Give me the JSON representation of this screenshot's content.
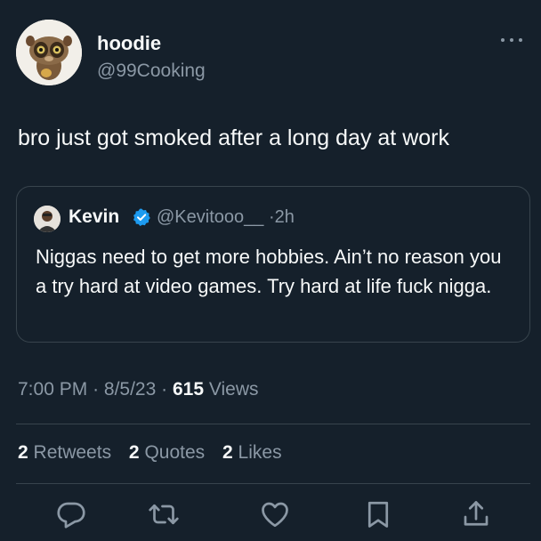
{
  "author": {
    "name": "hoodie",
    "handle": "@99Cooking"
  },
  "tweet_text": "bro just got smoked after a long day at work",
  "quoted": {
    "name": "Kevin",
    "handle": "@Kevitooo__",
    "separator": "·",
    "time_ago": "2h",
    "text": "Niggas need to get more hobbies. Ain’t no reason you a try hard at video games. Try hard at life fuck nigga."
  },
  "meta": {
    "time": "7:00 PM",
    "dot1": "·",
    "date": "8/5/23",
    "dot2": "·",
    "views_count": "615",
    "views_label": "Views"
  },
  "stats": {
    "retweets_count": "2",
    "retweets_label": "Retweets",
    "quotes_count": "2",
    "quotes_label": "Quotes",
    "likes_count": "2",
    "likes_label": "Likes"
  },
  "icons": {
    "more": "more-icon",
    "verified": "verified-badge-icon",
    "reply": "reply-icon",
    "retweet": "retweet-icon",
    "like": "like-icon",
    "bookmark": "bookmark-icon",
    "share": "share-icon"
  },
  "colors": {
    "background": "#15202b",
    "text": "#f7f9f9",
    "secondary": "#8b98a5",
    "border": "#38444d",
    "verified": "#1d9bf0"
  }
}
